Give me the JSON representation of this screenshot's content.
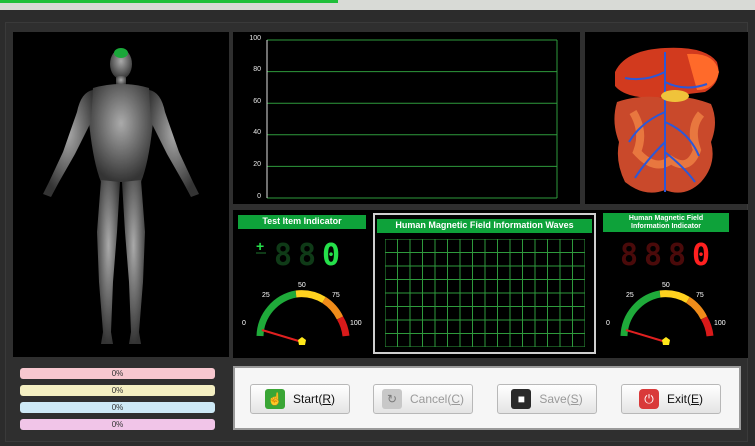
{
  "chart": {
    "y_ticks": [
      "100",
      "80",
      "60",
      "40",
      "20",
      "0"
    ]
  },
  "test_item_indicator": {
    "title": "Test Item Indicator",
    "sign": "+",
    "digits": [
      "8",
      "8",
      "0"
    ],
    "gauge": {
      "labels": [
        "0",
        "25",
        "50",
        "75",
        "100"
      ],
      "value": 0
    }
  },
  "waves": {
    "title": "Human Magnetic Field Information Waves"
  },
  "field_indicator": {
    "title_line1": "Human Magnetic Field",
    "title_line2": "Information Indicator",
    "digits": [
      "8",
      "8",
      "8",
      "0"
    ],
    "gauge": {
      "labels": [
        "0",
        "25",
        "50",
        "75",
        "100"
      ],
      "value": 0
    }
  },
  "progress_bars": [
    {
      "label": "0%",
      "value": 0,
      "color": "#f7c7cf"
    },
    {
      "label": "0%",
      "value": 0,
      "color": "#f4efc2"
    },
    {
      "label": "0%",
      "value": 0,
      "color": "#cde9f6"
    },
    {
      "label": "0%",
      "value": 0,
      "color": "#f1c5e8"
    }
  ],
  "buttons": {
    "start": {
      "label": "Start(",
      "key": "R",
      "end": ")"
    },
    "cancel": {
      "label": "Cancel(",
      "key": "C",
      "end": ")"
    },
    "save": {
      "label": "Save(",
      "key": "S",
      "end": ")"
    },
    "exit": {
      "label": "Exit(",
      "key": "E",
      "end": ")"
    }
  },
  "colors": {
    "accent_green": "#0ea23a",
    "grid_green": "#2e9a3c",
    "digit_green_on": "#25e04a",
    "digit_green_off": "#0f3a17",
    "digit_red_on": "#ff2020",
    "digit_red_off": "#4a0a0a"
  }
}
